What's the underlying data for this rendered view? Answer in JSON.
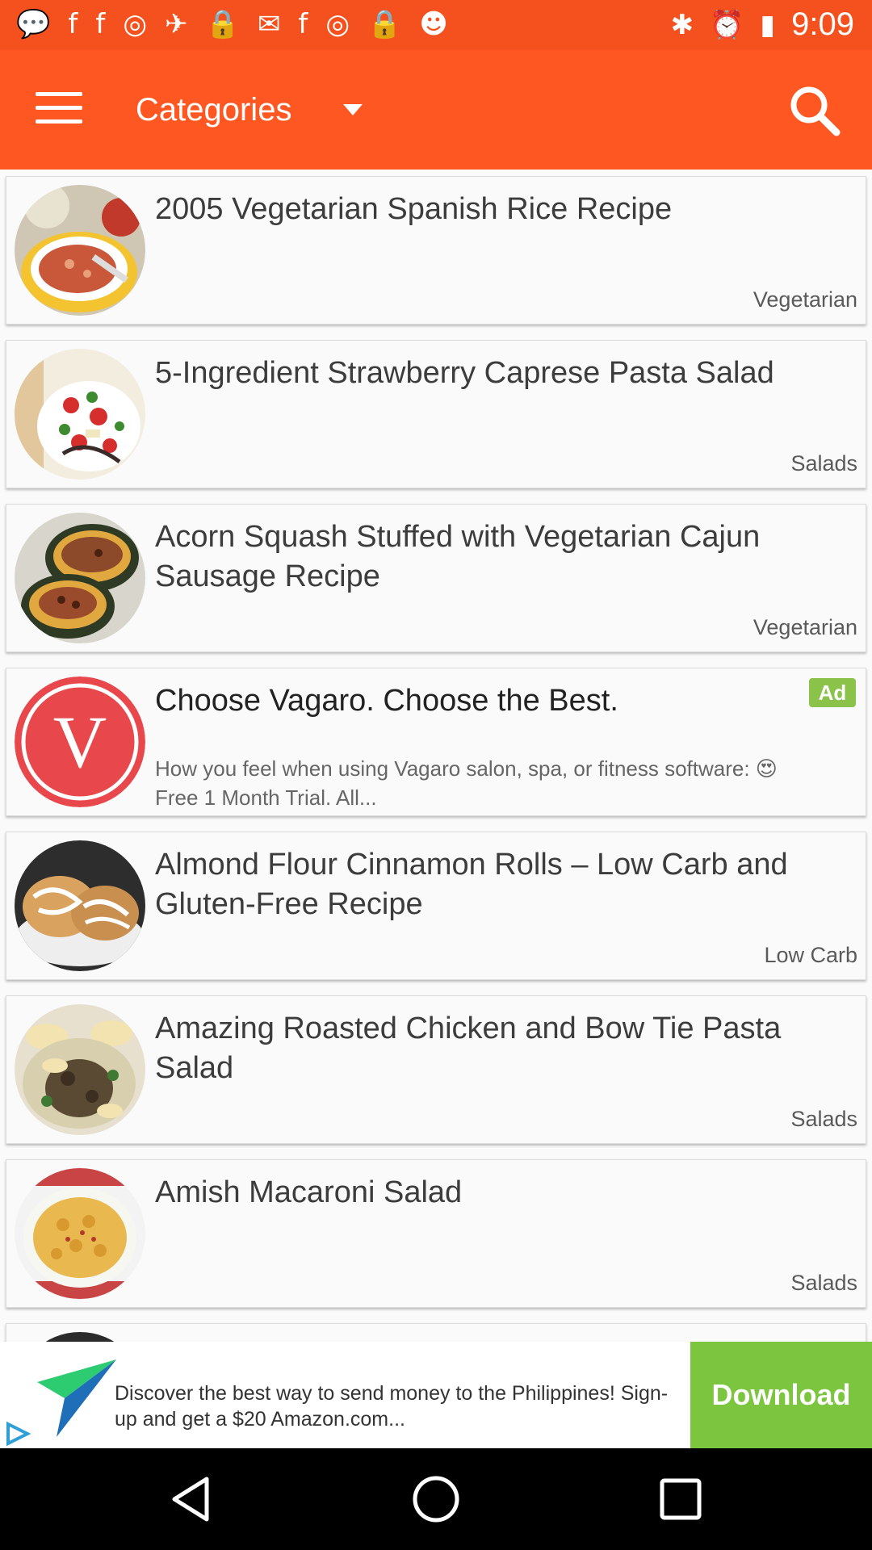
{
  "status_bar": {
    "time": "9:09",
    "left_icons": [
      "chat-icon",
      "facebook-icon",
      "facebook-icon",
      "opera-icon",
      "fake-gps-icon",
      "lock-icon",
      "mail-icon",
      "facebook-icon",
      "opera-icon",
      "lock-icon",
      "android-icon"
    ],
    "right_icons": [
      "bluetooth-icon",
      "alarm-icon",
      "battery-icon"
    ]
  },
  "toolbar": {
    "title": "Categories",
    "color": "#ff5722",
    "status_color": "#f4511e"
  },
  "recipes": [
    {
      "title": "2005 Vegetarian Spanish Rice Recipe",
      "category": "Vegetarian"
    },
    {
      "title": "5-Ingredient Strawberry Caprese Pasta Salad",
      "category": "Salads"
    },
    {
      "title": "Acorn Squash Stuffed with Vegetarian Cajun Sausage Recipe",
      "category": "Vegetarian"
    },
    {
      "title": "Almond Flour Cinnamon Rolls – Low Carb and Gluten-Free Recipe",
      "category": "Low Carb"
    },
    {
      "title": "Amazing Roasted Chicken and Bow Tie Pasta Salad",
      "category": "Salads"
    },
    {
      "title": "Amish Macaroni Salad",
      "category": "Salads"
    }
  ],
  "inline_ad": {
    "title": "Choose Vagaro. Choose the Best.",
    "badge": "Ad",
    "description": "How you feel when using Vagaro salon, spa, or fitness software: 😍 Free 1 Month Trial. All...",
    "logo_letter": "V",
    "logo_color": "#e8474c"
  },
  "banner_ad": {
    "text": "Discover the best way to send money to the Philippines! Sign-up and get a $20 Amazon.com...",
    "button": "Download",
    "button_color": "#7cc53e"
  }
}
